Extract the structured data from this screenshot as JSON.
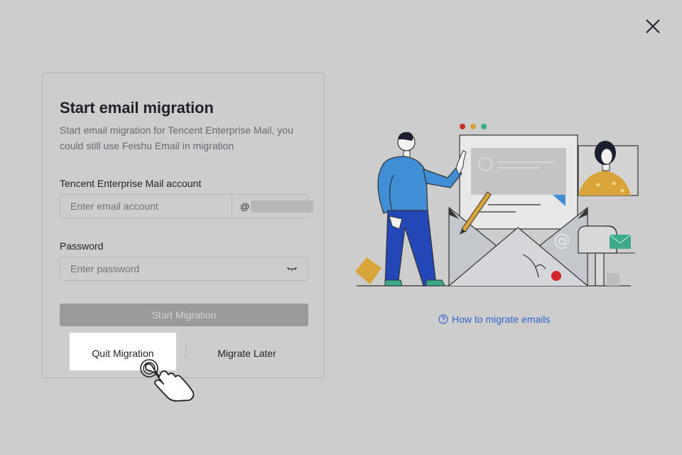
{
  "dialog": {
    "title": "Start email migration",
    "subtitle": "Start email migration for Tencent Enterprise Mail, you could still use Feishu Email in migration",
    "email": {
      "label": "Tencent Enterprise Mail account",
      "placeholder": "Enter email account",
      "domain_prefix": "@"
    },
    "password": {
      "label": "Password",
      "placeholder": "Enter password"
    },
    "start_button": "Start Migration",
    "quit_button": "Quit Migration",
    "later_button": "Migrate Later"
  },
  "help_link": "How to migrate emails",
  "icons": {
    "close": "close-icon",
    "eye": "eye-closed-icon",
    "help": "question-circle-icon",
    "cursor": "hand-pointer-icon"
  },
  "colors": {
    "background": "#cdcdcd",
    "primary_disabled": "#9a9a9a",
    "link": "#3366cc"
  }
}
